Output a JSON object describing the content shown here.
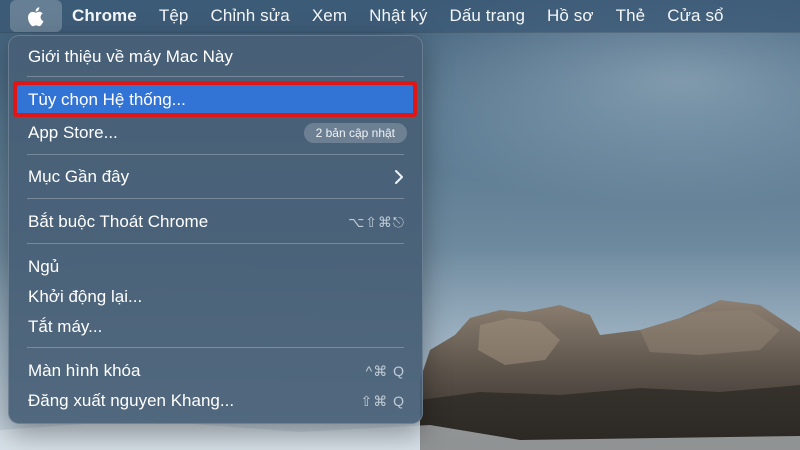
{
  "menubar": {
    "apple_icon": "apple-logo-icon",
    "app_name": "Chrome",
    "items": [
      "Tệp",
      "Chỉnh sửa",
      "Xem",
      "Nhật ký",
      "Dấu trang",
      "Hồ sơ",
      "Thẻ",
      "Cửa sổ"
    ]
  },
  "apple_menu": {
    "about": "Giới thiệu về máy Mac Này",
    "system_prefs": "Tùy chọn Hệ thống...",
    "app_store": "App Store...",
    "app_store_badge": "2 bản cập nhật",
    "recent_items": "Mục Gần đây",
    "force_quit": "Bắt buộc Thoát Chrome",
    "force_quit_shortcut": "⌥⇧⌘⎋",
    "sleep": "Ngủ",
    "restart": "Khởi động lại...",
    "shutdown": "Tắt máy...",
    "lock_screen": "Màn hình khóa",
    "lock_screen_shortcut": "^⌘ Q",
    "logout": "Đăng xuất nguyen Khang...",
    "logout_shortcut": "⇧⌘ Q"
  },
  "colors": {
    "selection": "#3273d6",
    "annotation_box": "#e01616"
  }
}
